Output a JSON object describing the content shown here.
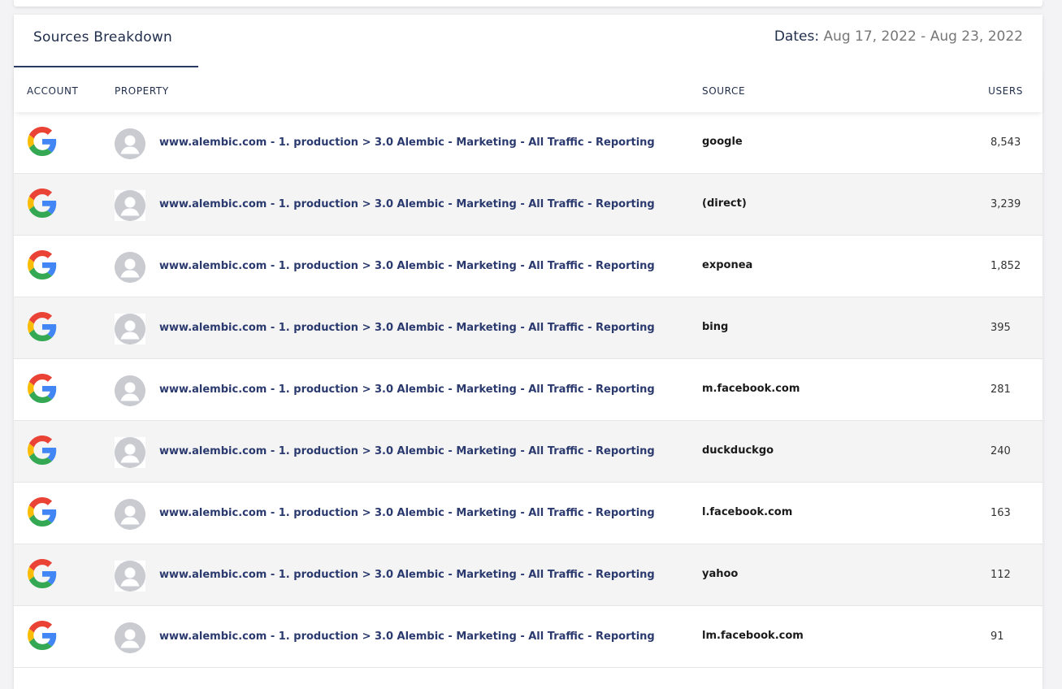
{
  "header": {
    "title": "Sources Breakdown",
    "dates_label": "Dates:",
    "dates_value": "Aug 17, 2022 - Aug 23, 2022"
  },
  "columns": {
    "account": "ACCOUNT",
    "property": "PROPERTY",
    "source": "SOURCE",
    "users": "USERS"
  },
  "colors": {
    "accent": "#2b3a63",
    "link": "#2b3a6e",
    "row_alt": "#f4f4f5"
  },
  "rows": [
    {
      "account_icon": "google-icon",
      "property": "www.alembic.com - 1. production > 3.0 Alembic - Marketing - All Traffic - Reporting",
      "source": "google",
      "users": "8,543"
    },
    {
      "account_icon": "google-icon",
      "property": "www.alembic.com - 1. production > 3.0 Alembic - Marketing - All Traffic - Reporting",
      "source": "(direct)",
      "users": "3,239"
    },
    {
      "account_icon": "google-icon",
      "property": "www.alembic.com - 1. production > 3.0 Alembic - Marketing - All Traffic - Reporting",
      "source": "exponea",
      "users": "1,852"
    },
    {
      "account_icon": "google-icon",
      "property": "www.alembic.com - 1. production > 3.0 Alembic - Marketing - All Traffic - Reporting",
      "source": "bing",
      "users": "395"
    },
    {
      "account_icon": "google-icon",
      "property": "www.alembic.com - 1. production > 3.0 Alembic - Marketing - All Traffic - Reporting",
      "source": "m.facebook.com",
      "users": "281"
    },
    {
      "account_icon": "google-icon",
      "property": "www.alembic.com - 1. production > 3.0 Alembic - Marketing - All Traffic - Reporting",
      "source": "duckduckgo",
      "users": "240"
    },
    {
      "account_icon": "google-icon",
      "property": "www.alembic.com - 1. production > 3.0 Alembic - Marketing - All Traffic - Reporting",
      "source": "l.facebook.com",
      "users": "163"
    },
    {
      "account_icon": "google-icon",
      "property": "www.alembic.com - 1. production > 3.0 Alembic - Marketing - All Traffic - Reporting",
      "source": "yahoo",
      "users": "112"
    },
    {
      "account_icon": "google-icon",
      "property": "www.alembic.com - 1. production > 3.0 Alembic - Marketing - All Traffic - Reporting",
      "source": "lm.facebook.com",
      "users": "91"
    }
  ]
}
